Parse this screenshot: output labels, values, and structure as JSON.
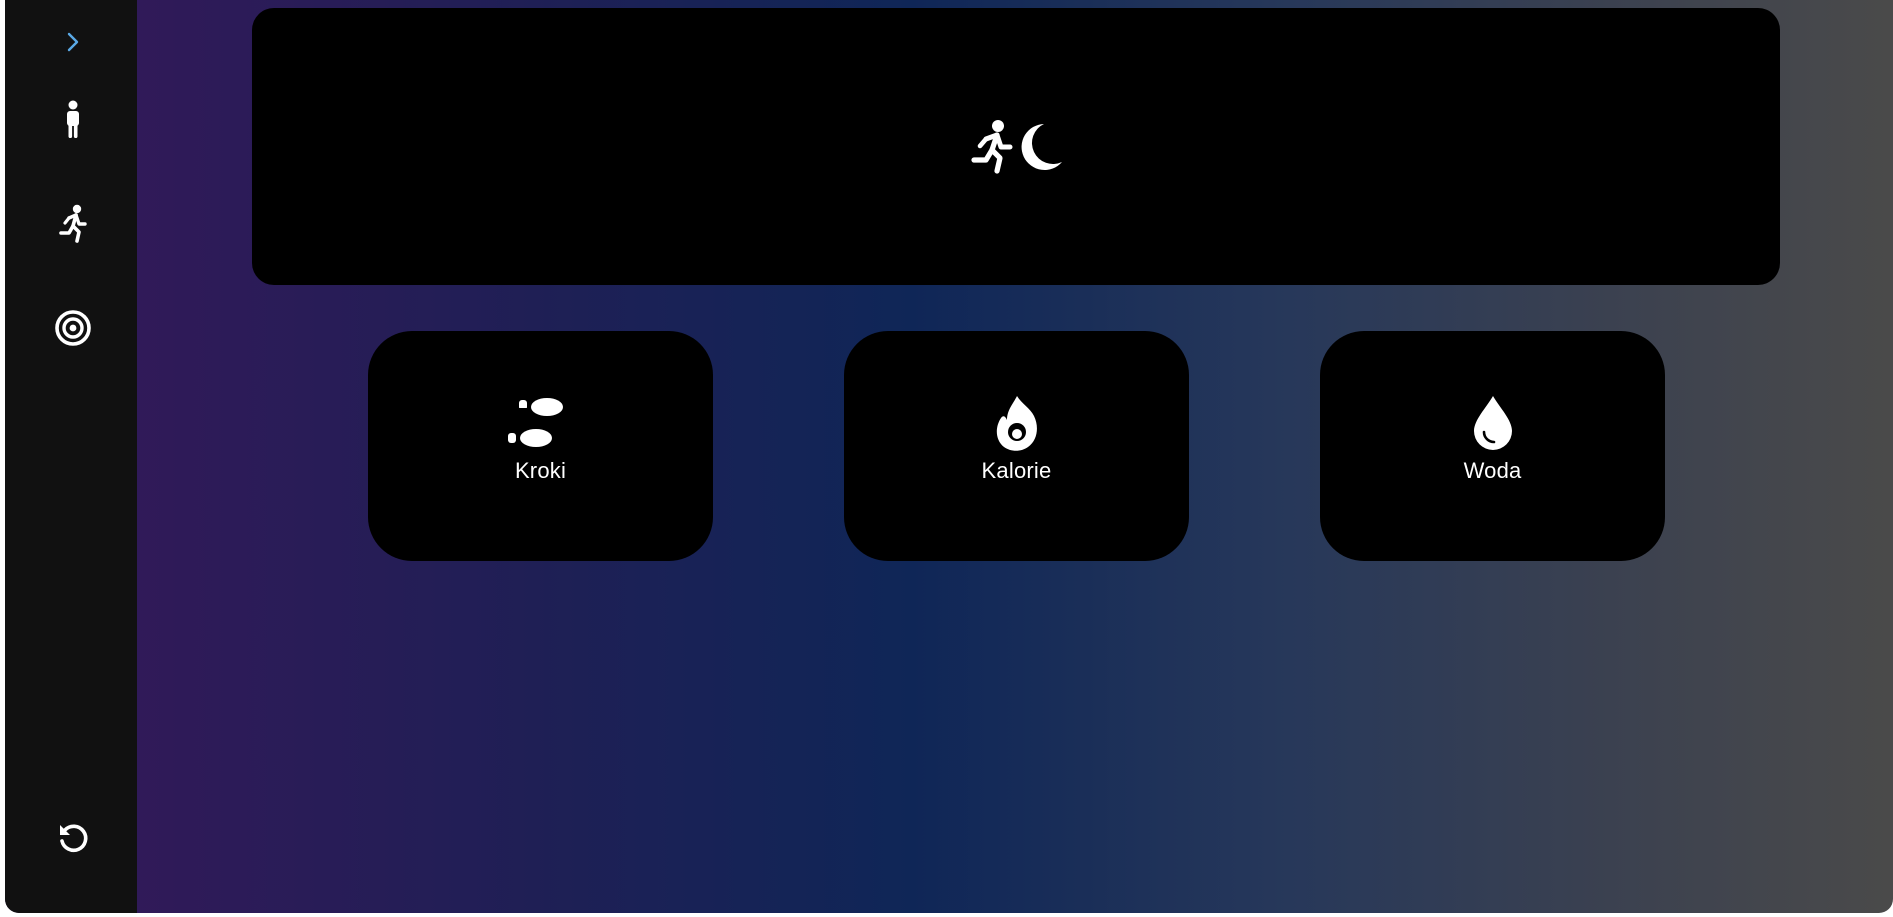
{
  "sidebar": {
    "items": [
      {
        "icon": "chevron-right-icon",
        "color": "#5aa9e6"
      },
      {
        "icon": "person-standing-icon"
      },
      {
        "icon": "person-running-icon"
      },
      {
        "icon": "target-icon"
      },
      {
        "icon": "reset-icon"
      }
    ]
  },
  "hero": {
    "icons": [
      "person-running-icon",
      "crescent-moon-icon"
    ]
  },
  "cards": [
    {
      "label": "Kroki",
      "icon": "footprints-icon"
    },
    {
      "label": "Kalorie",
      "icon": "flame-icon"
    },
    {
      "label": "Woda",
      "icon": "water-drop-icon"
    }
  ],
  "colors": {
    "accent": "#5aa9e6",
    "panel": "#000000",
    "sidebar": "#111111",
    "gradient_start": "#36185a",
    "gradient_mid": "#0f2657",
    "gradient_end": "#4a4a4a"
  }
}
